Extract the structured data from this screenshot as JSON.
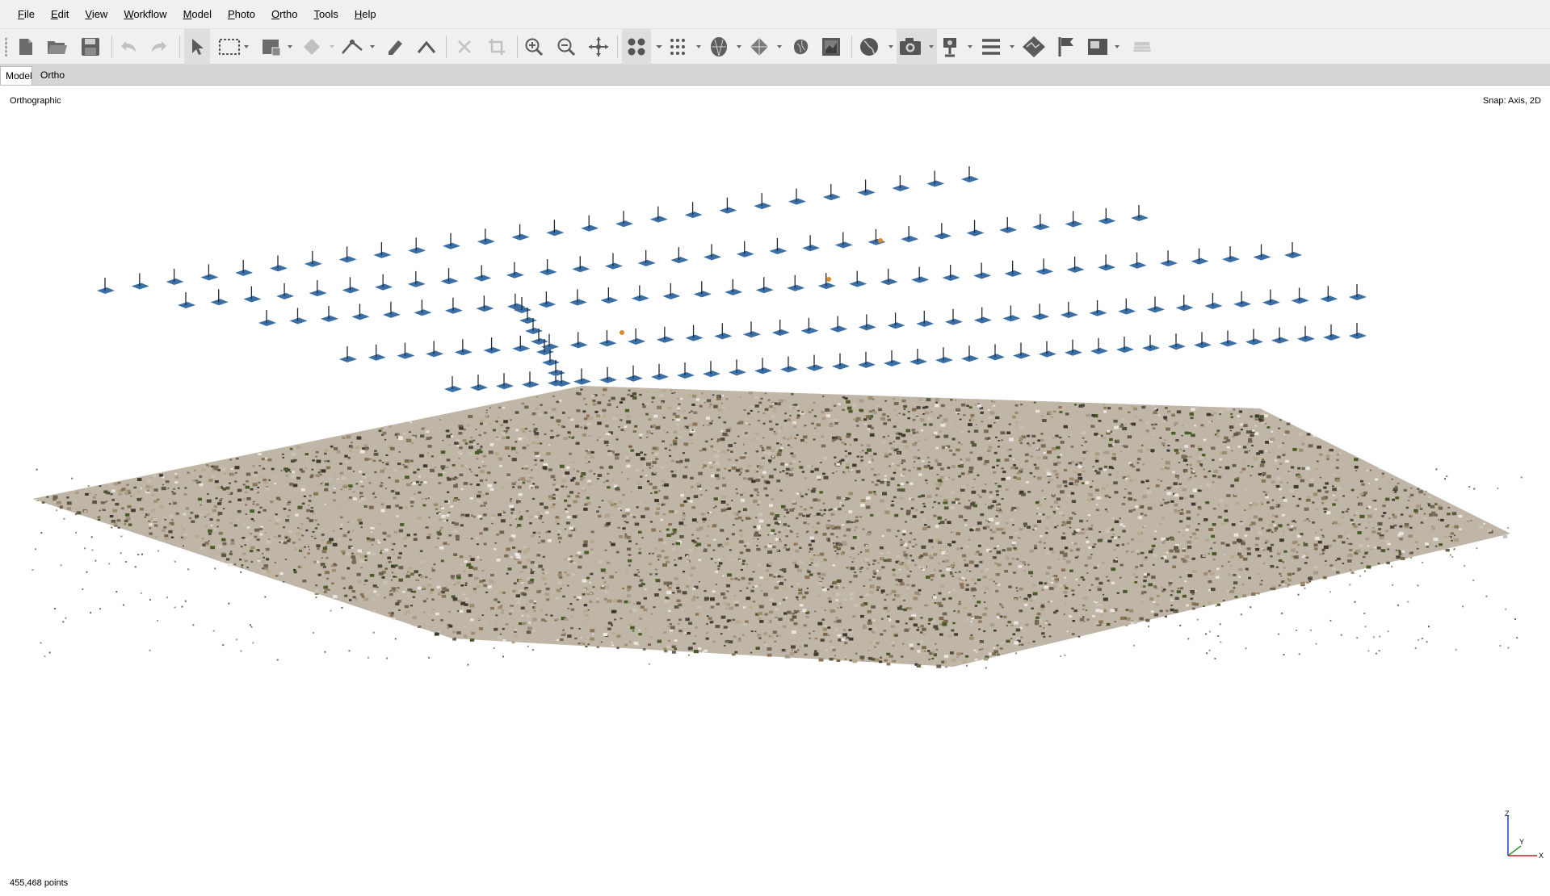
{
  "menu": [
    "File",
    "Edit",
    "View",
    "Workflow",
    "Model",
    "Photo",
    "Ortho",
    "Tools",
    "Help"
  ],
  "toolbar": {
    "icons": [
      "new-icon",
      "open-icon",
      "save-icon",
      "undo-icon",
      "redo-icon",
      "navigation-icon",
      "rectangle-selection-icon",
      "resize-region-icon",
      "rotate-object-icon",
      "ruler-icon",
      "shape-icon",
      "delete-icon",
      "crop-icon",
      "zoom-in-icon",
      "zoom-out-icon",
      "reset-view-icon",
      "show-points-icon",
      "show-dense-cloud-icon",
      "show-mesh-icon",
      "show-tiled-model-icon",
      "show-dem-icon",
      "show-orthomosaic-icon",
      "show-region-icon",
      "show-cameras-icon",
      "show-markers-icon",
      "show-shapes-icon",
      "show-layers-icon",
      "show-images-icon",
      "show-grid-icon"
    ]
  },
  "tabs": [
    "Model",
    "Ortho"
  ],
  "viewport": {
    "projection_label": "Orthographic",
    "snap_label": "Snap: Axis, 2D",
    "points_label": "455,468 points",
    "axes": {
      "z": "Z",
      "y": "Y",
      "x": "X"
    }
  },
  "colors": {
    "camera_blue": "#3a6ea5",
    "ground_brown": "#8a7a5e",
    "vegetation_green": "#4a5a28",
    "accent_orange": "#d98a2a"
  }
}
